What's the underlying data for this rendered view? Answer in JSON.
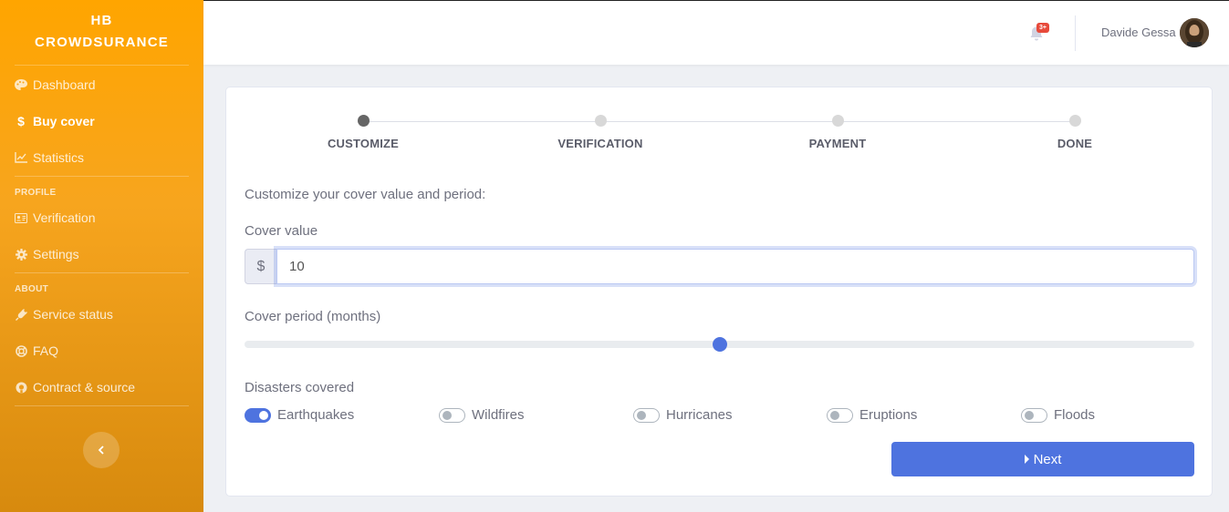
{
  "brand": {
    "line1": "HB",
    "line2": "CROWDSURANCE"
  },
  "sidebar": {
    "items": [
      {
        "label": "Dashboard",
        "icon": "palette-icon"
      },
      {
        "label": "Buy cover",
        "icon": "dollar-icon",
        "active": true
      },
      {
        "label": "Statistics",
        "icon": "chart-line-icon"
      }
    ],
    "profile_heading": "PROFILE",
    "profile_items": [
      {
        "label": "Verification",
        "icon": "id-card-icon"
      },
      {
        "label": "Settings",
        "icon": "cog-icon"
      }
    ],
    "about_heading": "ABOUT",
    "about_items": [
      {
        "label": "Service status",
        "icon": "plug-icon"
      },
      {
        "label": "FAQ",
        "icon": "life-ring-icon"
      },
      {
        "label": "Contract & source",
        "icon": "github-icon"
      }
    ],
    "collapse_icon": "chevron-left-icon"
  },
  "topbar": {
    "notification_count": "3+",
    "user_name": "Davide Gessa"
  },
  "steps": [
    {
      "label": "CUSTOMIZE",
      "active": true
    },
    {
      "label": "VERIFICATION",
      "active": false
    },
    {
      "label": "PAYMENT",
      "active": false
    },
    {
      "label": "DONE",
      "active": false
    }
  ],
  "form": {
    "intro": "Customize your cover value and period:",
    "cover_value_label": "Cover value",
    "currency_symbol": "$",
    "cover_value": "10",
    "cover_period_label": "Cover period (months)",
    "cover_period_fraction": 0.5,
    "disasters_label": "Disasters covered",
    "disasters": [
      {
        "label": "Earthquakes",
        "on": true
      },
      {
        "label": "Wildfires",
        "on": false
      },
      {
        "label": "Hurricanes",
        "on": false
      },
      {
        "label": "Eruptions",
        "on": false
      },
      {
        "label": "Floods",
        "on": false
      }
    ],
    "next_label": "Next"
  },
  "colors": {
    "accent": "#4e73df",
    "sidebar": "#ffa500"
  }
}
